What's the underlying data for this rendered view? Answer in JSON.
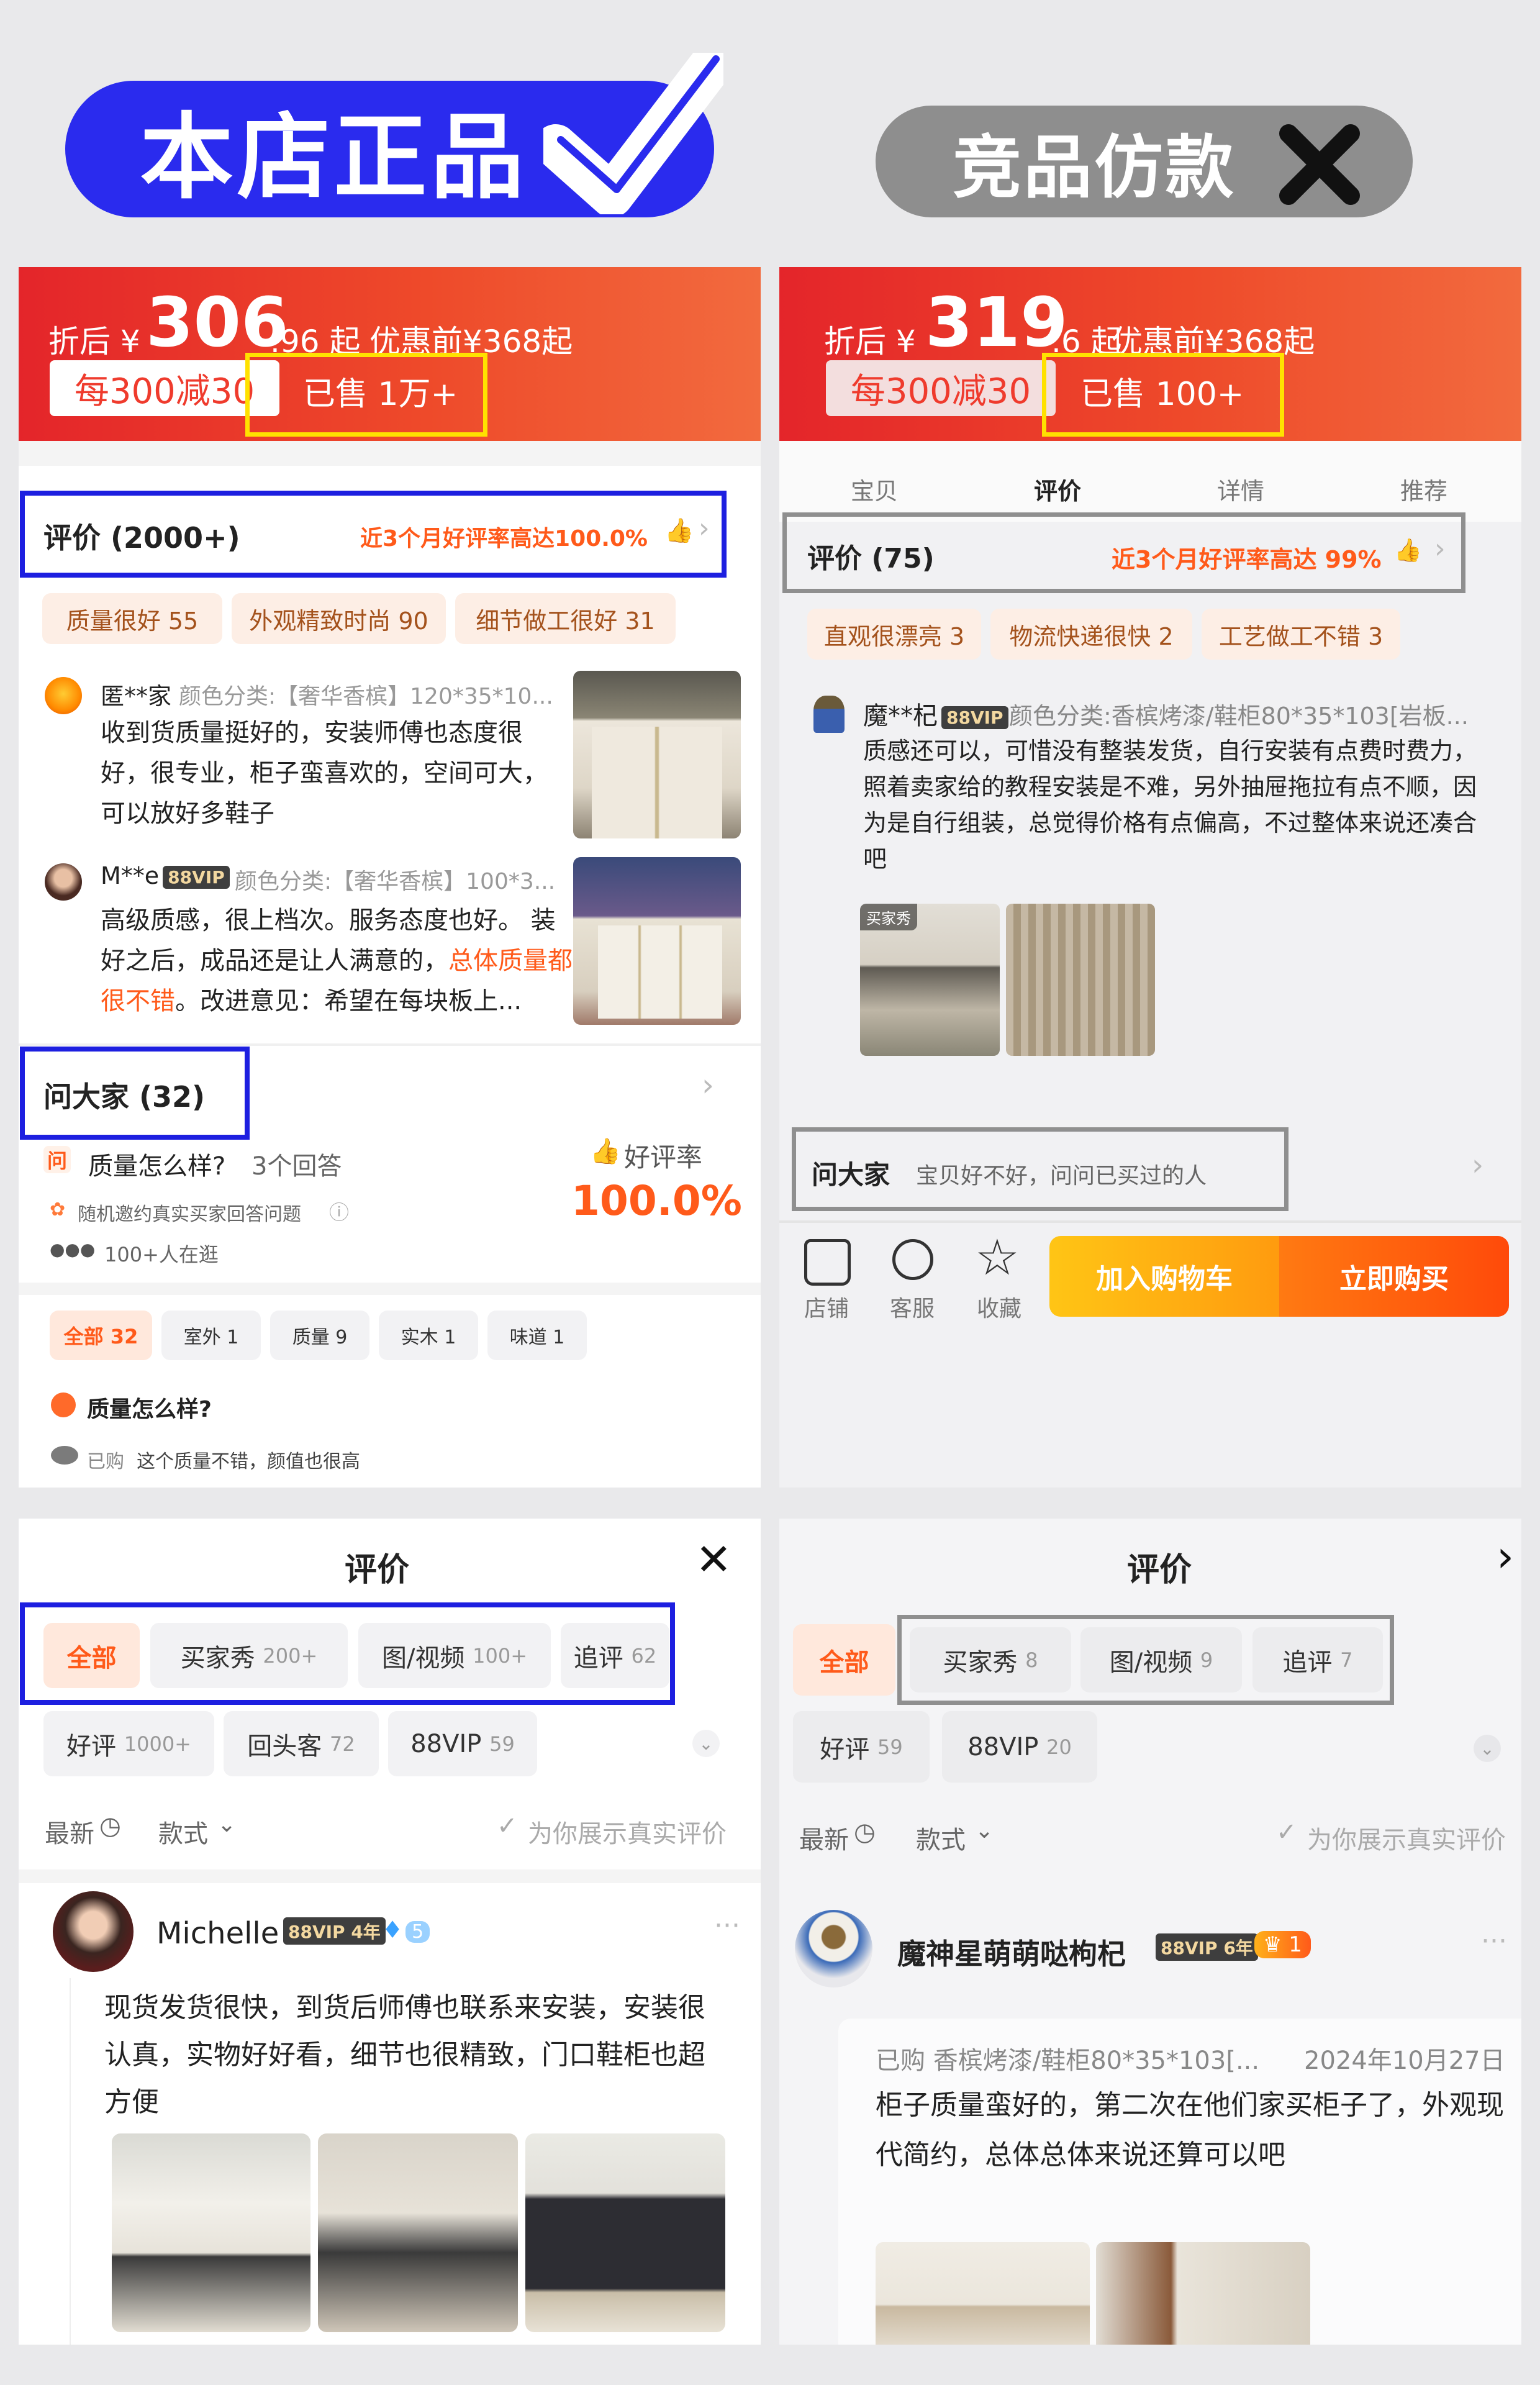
{
  "header": {
    "genuine_label": "本店正品",
    "fake_label": "竞品仿款",
    "colors": {
      "genuine_pill": "#2a2bee",
      "fake_pill": "#8e8e8e"
    }
  },
  "left_top": {
    "price_prefix": "折后 ¥",
    "price_int": "306",
    "price_dec": ".96 起",
    "original": "优惠前¥368起",
    "discount": "每300减30",
    "sold": "已售 1万+",
    "reviews_title": "评价 (2000+)",
    "reviews_rate": "近3个月好评率高达100.0%",
    "tags": [
      "质量很好 55",
      "外观精致时尚 90",
      "细节做工很好 31"
    ],
    "review1": {
      "user": "匿**家",
      "spec": "颜色分类:【奢华香槟】120*35*10...",
      "text": "收到货质量挺好的，安装师傅也态度很好，很专业，柜子蛮喜欢的，空间可大，可以放好多鞋子"
    },
    "review2": {
      "user": "M**e",
      "vip": "88VIP",
      "spec": "颜色分类:【奢华香槟】100*3...",
      "text_a": "高级质感，很上档次。服务态度也好。 装好之后，成品还是让人满意的，",
      "text_hl": "总体质量都很不错",
      "text_b": "。改进意见：希望在每块板上..."
    },
    "qa_title": "问大家 (32)",
    "qa_icon": "问",
    "qa_q": "质量怎么样?",
    "qa_answers": "3个回答",
    "qa_invite": "随机邀约真实买家回答问题",
    "qa_people": "100+人在逛",
    "rate_label": "好评率",
    "rate_value": "100.0%",
    "qa_tags": [
      "全部 32",
      "室外 1",
      "质量 9",
      "实木 1",
      "味道 1"
    ],
    "qa_q2": "质量怎么样?",
    "qa_a2_prefix": "已购",
    "qa_a2": "这个质量不错，颜值也很高"
  },
  "right_top": {
    "price_prefix": "折后 ¥",
    "price_int": "319",
    "price_dec": ".6 起",
    "original": "优惠前¥368起",
    "discount": "每300减30",
    "sold": "已售 100+",
    "tabs": [
      "宝贝",
      "评价",
      "详情",
      "推荐"
    ],
    "reviews_title": "评价 (75)",
    "reviews_rate": "近3个月好评率高达 99%",
    "tags": [
      "直观很漂亮 3",
      "物流快递很快 2",
      "工艺做工不错 3"
    ],
    "review1": {
      "user": "魔**杞",
      "vip": "88VIP",
      "spec": "颜色分类:香槟烤漆/鞋柜80*35*103[岩板...",
      "text": "质感还可以，可惜没有整装发货，自行安装有点费时费力，照着卖家给的教程安装是不难，另外抽屉拖拉有点不顺，因为是自行组装，总觉得价格有点偏高，不过整体来说还凑合吧"
    },
    "photo_badge": "买家秀",
    "qa_title": "问大家",
    "qa_hint": "宝贝好不好，问问已买过的人",
    "bar_icons": [
      "店铺",
      "客服",
      "收藏"
    ],
    "btn_cart": "加入购物车",
    "btn_buy": "立即购买"
  },
  "left_bottom": {
    "title": "评价",
    "chips": [
      {
        "t": "全部",
        "c": ""
      },
      {
        "t": "买家秀",
        "c": "200+"
      },
      {
        "t": "图/视频",
        "c": "100+"
      },
      {
        "t": "追评",
        "c": "62"
      }
    ],
    "chips2": [
      {
        "t": "好评",
        "c": "1000+"
      },
      {
        "t": "回头客",
        "c": "72"
      },
      {
        "t": "88VIP",
        "c": "59"
      }
    ],
    "sort": "最新",
    "style": "款式",
    "real": "为你展示真实评价",
    "user": "Michelle",
    "vip": "88VIP",
    "vip_years": "4年",
    "diamond": "5",
    "text": "现货发货很快，到货后师傅也联系来安装，安装很认真，实物好好看，细节也很精致，门口鞋柜也超方便"
  },
  "right_bottom": {
    "title": "评价",
    "chips": [
      {
        "t": "全部",
        "c": ""
      },
      {
        "t": "买家秀",
        "c": "8"
      },
      {
        "t": "图/视频",
        "c": "9"
      },
      {
        "t": "追评",
        "c": "7"
      }
    ],
    "chips2": [
      {
        "t": "好评",
        "c": "59"
      },
      {
        "t": "88VIP",
        "c": "20"
      }
    ],
    "sort": "最新",
    "style": "款式",
    "real": "为你展示真实评价",
    "user": "魔神星萌萌哒枸杞",
    "vip": "88VIP",
    "vip_years": "6年",
    "crown": "1",
    "purchased": "已购 香槟烤漆/鞋柜80*35*103[...",
    "date": "2024年10月27日",
    "text": "柜子质量蛮好的，第二次在他们家买柜子了，外观现代简约，总体总体来说还算可以吧"
  }
}
